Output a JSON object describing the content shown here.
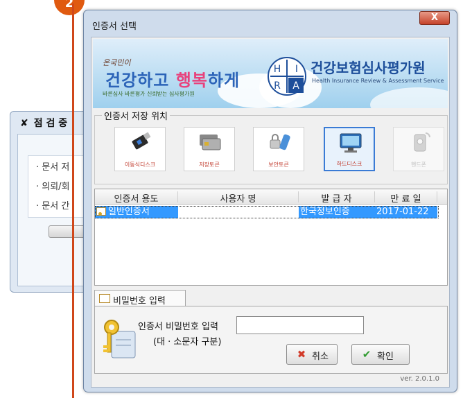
{
  "background_window": {
    "title": "점 검 중",
    "items": [
      "· 문서 저",
      "· 의뢰/회",
      "· 문서 간"
    ]
  },
  "step_badge": "2",
  "dialog": {
    "title": "인증서 선택",
    "close_label": "X",
    "banner": {
      "small": "온국민이",
      "slogan_part1": "건강하고 ",
      "slogan_part2": "행복",
      "slogan_part3": "하게",
      "tiny": "바른심사 바른평가 신뢰받는 심사평가원",
      "logo_letters": [
        "H",
        "I",
        "R",
        "A"
      ],
      "org_name": "건강보험심사평가원",
      "org_name_en": "Health Insurance Review & Assessment Service"
    },
    "storage": {
      "label": "인증서 저장 위치",
      "options": [
        {
          "label": "이동식디스크",
          "icon": "usb-drive-icon"
        },
        {
          "label": "저장토큰",
          "icon": "card-token-icon"
        },
        {
          "label": "보안토큰",
          "icon": "security-token-icon"
        },
        {
          "label": "하드디스크",
          "icon": "monitor-icon"
        },
        {
          "label": "핸드폰",
          "icon": "phone-icon"
        }
      ]
    },
    "cert_list": {
      "columns": [
        "인증서 용도",
        "사용자 명",
        "발 급 자",
        "만 료 일"
      ],
      "rows": [
        {
          "purpose": "일반인증서",
          "user": "",
          "issuer": "한국정보인증",
          "expiry": "2017-01-22"
        }
      ]
    },
    "password": {
      "tab_label": "비밀번호 입력",
      "field_label": "인증서 비밀번호 입력",
      "hint": "(대 · 소문자 구분)",
      "value": "",
      "cancel_label": "취소",
      "ok_label": "확인"
    },
    "version": "ver. 2.0.1.0"
  },
  "colors": {
    "selection": "#3399ff",
    "highlight_outline": "#d0471a",
    "title_bar": "#cfdcec"
  }
}
